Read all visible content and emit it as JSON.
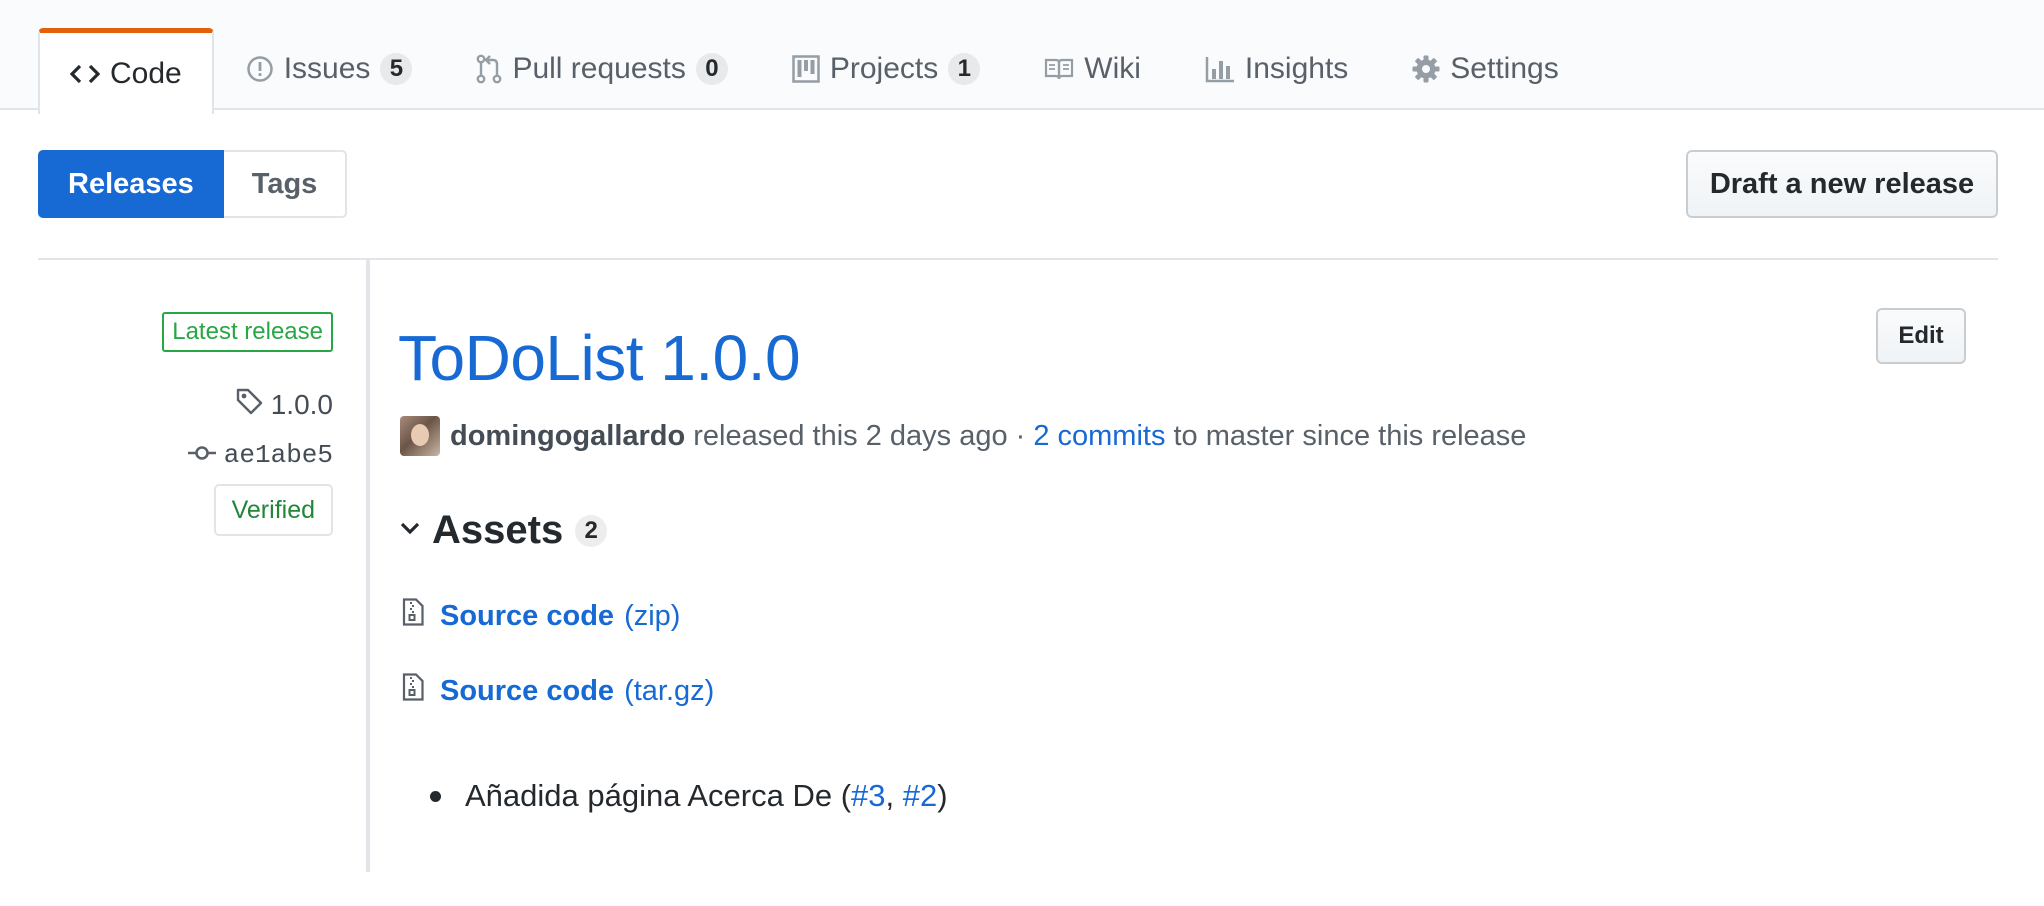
{
  "nav": {
    "tabs": [
      {
        "label": "Code",
        "icon": "code-icon",
        "selected": true
      },
      {
        "label": "Issues",
        "count": "5",
        "icon": "issue-opened-icon"
      },
      {
        "label": "Pull requests",
        "count": "0",
        "icon": "git-pull-request-icon"
      },
      {
        "label": "Projects",
        "count": "1",
        "icon": "project-icon"
      },
      {
        "label": "Wiki",
        "icon": "book-icon"
      },
      {
        "label": "Insights",
        "icon": "graph-icon"
      },
      {
        "label": "Settings",
        "icon": "gear-icon"
      }
    ],
    "accent_color": "#e36209"
  },
  "subnav": {
    "releases": "Releases",
    "tags": "Tags",
    "draft_button": "Draft a new release",
    "selected_color": "#1769d4"
  },
  "release": {
    "latest_label": "Latest release",
    "tag": "1.0.0",
    "commit": "ae1abe5",
    "verified": "Verified",
    "title": "ToDoList 1.0.0",
    "edit_label": "Edit",
    "author": "domingogallardo",
    "released_text": "released this 2 days ago ·",
    "commits_link": "2 commits",
    "since_text": "to master since this release",
    "assets_label": "Assets",
    "assets_count": "2",
    "assets": [
      {
        "name": "Source code",
        "kind": "(zip)"
      },
      {
        "name": "Source code",
        "kind": "(tar.gz)"
      }
    ],
    "notes": {
      "text": "Añadida página Acerca De (",
      "link1": "#3",
      "sep": ", ",
      "link2": "#2",
      "close": ")"
    }
  }
}
